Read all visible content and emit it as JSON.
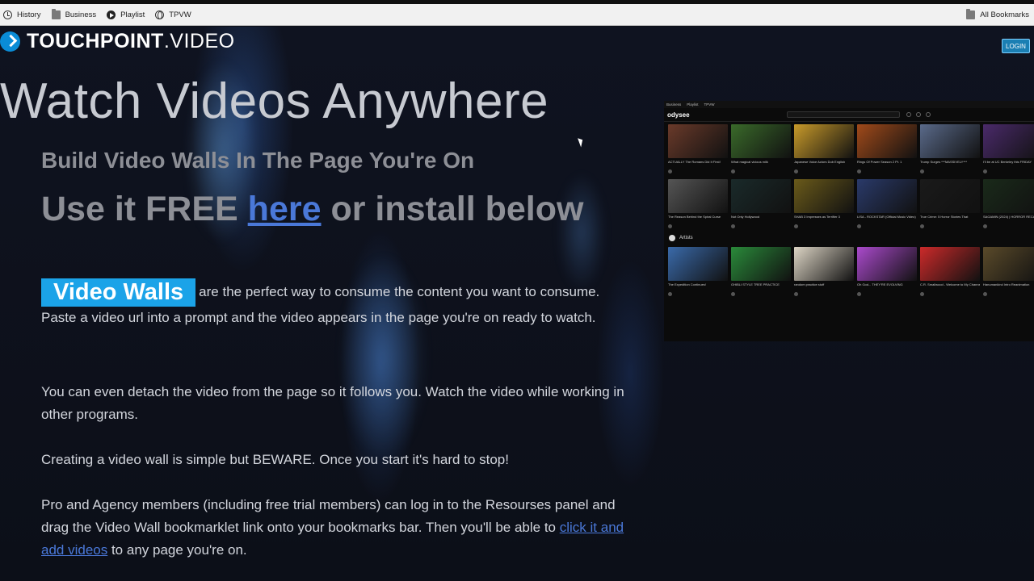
{
  "bookmarks": {
    "items": [
      {
        "label": "History",
        "icon": "history-icon"
      },
      {
        "label": "Business",
        "icon": "folder-icon"
      },
      {
        "label": "Playlist",
        "icon": "playlist-icon"
      },
      {
        "label": "TPVW",
        "icon": "globe-icon"
      }
    ],
    "all_label": "All Bookmarks"
  },
  "brand": {
    "bold": "TOUCHPOINT",
    "rest": ".VIDEO"
  },
  "login_label": "LOGIN",
  "hero": {
    "title": "Watch Videos Anywhere",
    "subtitle": "Build Video Walls In The Page You're On",
    "cta_pre": "Use it FREE ",
    "cta_link": "here",
    "cta_post": " or install below"
  },
  "body": {
    "badge": "Video Walls",
    "p1": "are the perfect way to consume the content you want to consume. Paste a video url into a prompt and the video appears in the page you're on ready to watch.",
    "p2": "You can even detach the video from the page so it follows you. Watch the video while working in other programs.",
    "p3": "Creating a video wall is simple but BEWARE. Once you start it's hard to stop!",
    "p4_pre": "Pro and Agency members (including free trial members) can log in to the Resourses panel and drag the Video Wall bookmarklet link onto your bookmarks bar. Then you'll be able to ",
    "p4_link": "click it and add videos",
    "p4_post": " to any page you're on."
  },
  "preview": {
    "top_items": [
      "Business",
      "Playlist",
      "TPVW"
    ],
    "logo": "odysee",
    "section_label": "Artists",
    "row1": [
      {
        "color": "#6a3a2a",
        "cap": "ACTUALLY The Romans Did It First!"
      },
      {
        "color": "#3a6a2a",
        "cap": "What magical vicious milk"
      },
      {
        "color": "#c89a2a",
        "cap": "Japanese Voice Actors Dub English"
      },
      {
        "color": "#a04a1a",
        "cap": "Rings Of Power Season 2 Pt. 1"
      },
      {
        "color": "#5a6a8a",
        "cap": "Trump Surges ***MASSIVELY***"
      },
      {
        "color": "#4a2a6a",
        "cap": "I'll be at UC Berkeley this FRIDAY"
      }
    ],
    "row2": [
      {
        "color": "#555555",
        "cap": "The Reason Behind the Spiral Curse"
      },
      {
        "color": "#1a2a2a",
        "cap": "Not Only Hollywood"
      },
      {
        "color": "#6a5a1a",
        "cap": "SHAB 3 Impresses as Terrifier 3"
      },
      {
        "color": "#2a3a6a",
        "cap": "LISA - ROCKSTAR (Official Music Video)"
      },
      {
        "color": "#1a1a1a",
        "cap": "True Crime: 5 Horror Stories That"
      },
      {
        "color": "#1a2a1a",
        "cap": "SAGAMIN (2024) | HORROR RECAP"
      }
    ],
    "row3": [
      {
        "color": "#3a6aaa",
        "cap": "The Expedition Continues!"
      },
      {
        "color": "#2a8a3a",
        "cap": "GHIBLI STYLE TREE PRACTICE"
      },
      {
        "color": "#ddd5c5",
        "cap": "random practice stuff"
      },
      {
        "color": "#aa4acc",
        "cap": "Oh God... THEY'RE EVOLVING"
      },
      {
        "color": "#cc2a2a",
        "cap": "C.R. Smallwood - Welcome to My Channel"
      },
      {
        "color": "#5a4a2a",
        "cap": "Hanumankind Intro Reanimation"
      }
    ]
  }
}
